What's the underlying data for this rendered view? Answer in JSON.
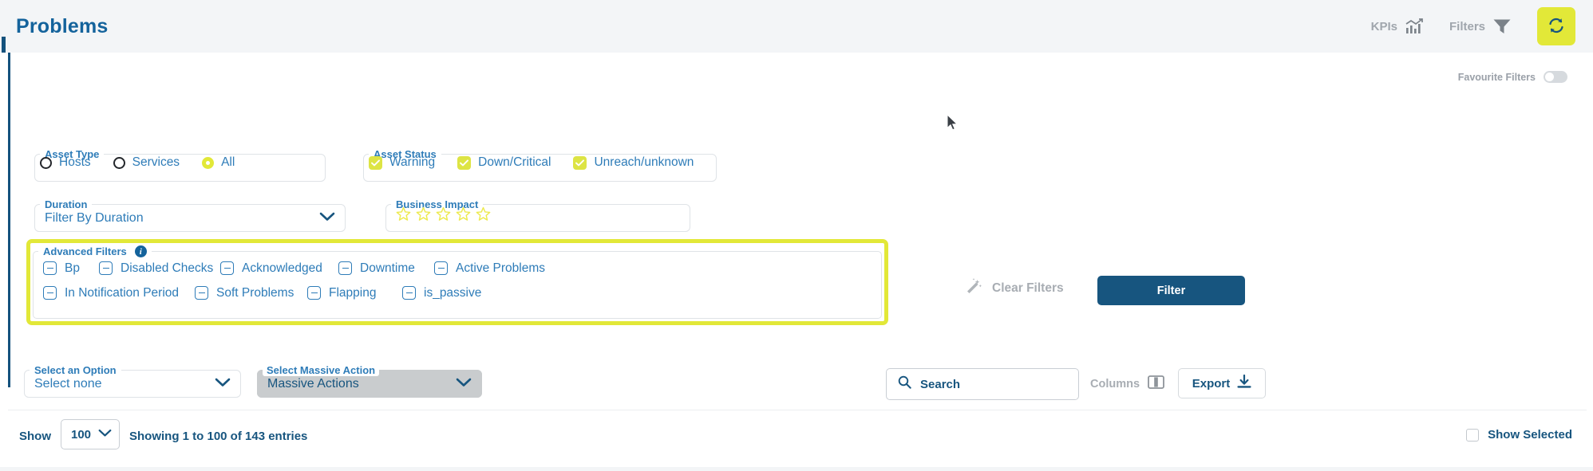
{
  "header": {
    "title": "Problems",
    "kpis_label": "KPIs",
    "kpis_icon": "chart-bars-icon",
    "filters_label": "Filters",
    "filters_icon": "funnel-icon",
    "refresh_icon": "refresh-icon",
    "refresh_color": "#e2e838",
    "title_color": "#14639c"
  },
  "filters": {
    "favourite_filters_label": "Favourite Filters",
    "asset_type": {
      "legend": "Asset Type",
      "options": [
        {
          "label": "Hosts",
          "selected": false
        },
        {
          "label": "Services",
          "selected": false
        },
        {
          "label": "All",
          "selected": true
        }
      ]
    },
    "asset_status": {
      "legend": "Asset Status",
      "options": [
        {
          "label": "Warning",
          "checked": true
        },
        {
          "label": "Down/Critical",
          "checked": true
        },
        {
          "label": "Unreach/unknown",
          "checked": true
        }
      ]
    },
    "duration": {
      "legend": "Duration",
      "value": "Filter By Duration"
    },
    "business_impact": {
      "legend": "Business Impact",
      "stars_total": 5,
      "stars_filled": 0,
      "star_color": "#edea4e"
    },
    "advanced": {
      "legend": "Advanced Filters",
      "info_icon": "info-icon",
      "highlight_color": "#e2e838",
      "row1": [
        {
          "label": "Bp",
          "state": "indeterminate"
        },
        {
          "label": "Disabled Checks",
          "state": "indeterminate"
        },
        {
          "label": "Acknowledged",
          "state": "indeterminate"
        },
        {
          "label": "Downtime",
          "state": "indeterminate"
        },
        {
          "label": "Active Problems",
          "state": "indeterminate"
        }
      ],
      "row2": [
        {
          "label": "In Notification Period",
          "state": "indeterminate"
        },
        {
          "label": "Soft Problems",
          "state": "indeterminate"
        },
        {
          "label": "Flapping",
          "state": "indeterminate"
        },
        {
          "label": "is_passive",
          "state": "indeterminate"
        }
      ]
    },
    "clear_filters_label": "Clear Filters",
    "clear_filters_icon": "magic-wand-icon",
    "filter_button_label": "Filter",
    "filter_button_color": "#17557f"
  },
  "toolbar": {
    "select_option": {
      "legend": "Select an Option",
      "value": "Select none"
    },
    "massive_action": {
      "legend": "Select Massive Action",
      "value": "Massive Actions",
      "disabled": true
    },
    "search": {
      "label": "Search",
      "icon": "search-icon"
    },
    "columns_label": "Columns",
    "columns_icon": "columns-icon",
    "export_label": "Export",
    "export_icon": "download-icon"
  },
  "footer": {
    "show_label": "Show",
    "page_size": "100",
    "showing_text": "Showing 1 to 100 of 143 entries",
    "show_selected_label": "Show Selected",
    "show_selected_checked": false
  }
}
